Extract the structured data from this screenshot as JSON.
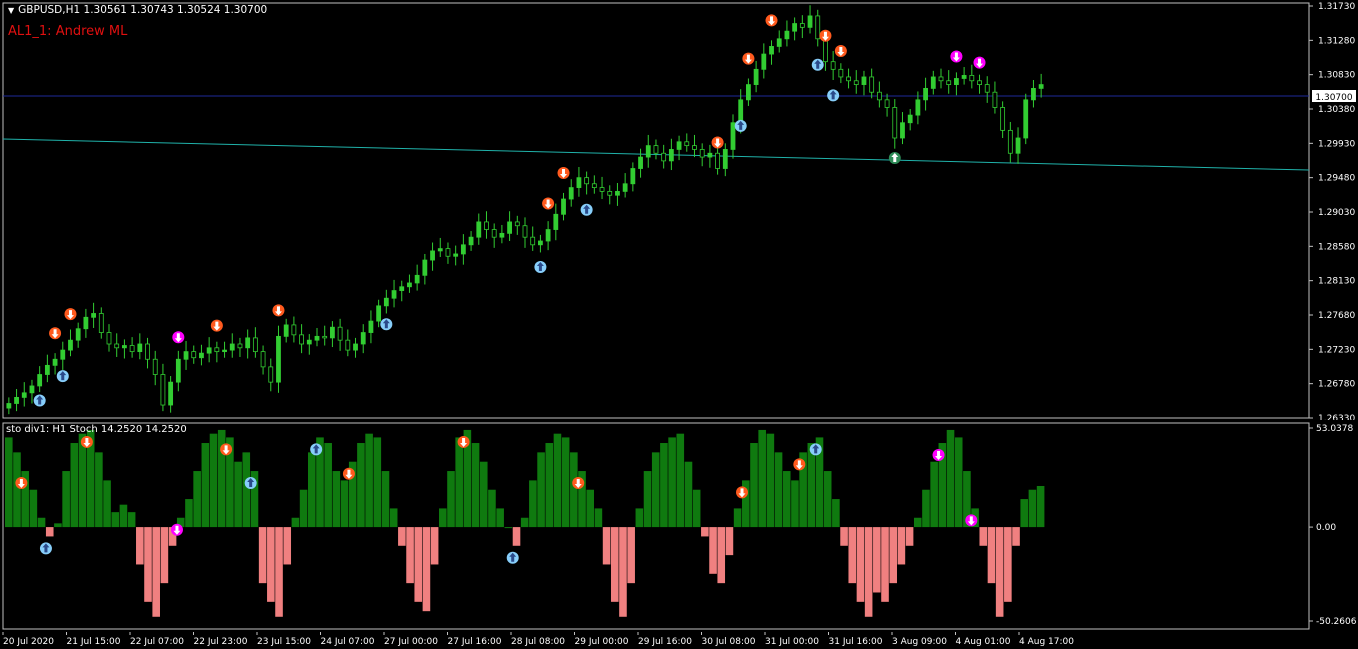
{
  "header": {
    "symbol_info": "GBPUSD,H1  1.30561 1.30743 1.30524 1.30700",
    "indicator_label": "AL1_1: Andrew ML",
    "sub_window_title": "sto div1: H1 Stoch 14.2520 14.2520"
  },
  "price_axis": {
    "labels": [
      "1.31730",
      "1.31280",
      "1.30830",
      "1.30380",
      "1.29930",
      "1.29480",
      "1.29030",
      "1.28580",
      "1.28130",
      "1.27680",
      "1.27230",
      "1.26780",
      "1.26330"
    ],
    "current_price_label": "1.30700"
  },
  "osc_axis": {
    "labels": [
      "53.0378",
      "0.00",
      "-50.2606"
    ]
  },
  "time_axis": {
    "labels": [
      "20 Jul 2020",
      "21 Jul 15:00",
      "22 Jul 07:00",
      "22 Jul 23:00",
      "23 Jul 15:00",
      "24 Jul 07:00",
      "27 Jul 00:00",
      "27 Jul 16:00",
      "28 Jul 08:00",
      "29 Jul 00:00",
      "29 Jul 16:00",
      "30 Jul 08:00",
      "31 Jul 00:00",
      "31 Jul 16:00",
      "3 Aug 09:00",
      "4 Aug 01:00",
      "4 Aug 17:00"
    ]
  },
  "colors": {
    "background": "#000000",
    "bull": "#32cd32",
    "osc_positive": "#0f7a0f",
    "osc_negative": "#f08080",
    "trendline": "#20b2aa",
    "price_level": "#1e2a9a",
    "sell_arrow": "#ff5a1e",
    "buy_arrow": "#87cefa",
    "hidden_div": "#ff00ff",
    "grid": "#c0c0c0"
  },
  "chart_data": [
    {
      "type": "candlestick",
      "title": "GBPUSD,H1",
      "ylim": [
        1.2633,
        1.3173
      ],
      "current_price": 1.307,
      "closes": [
        1.2652,
        1.266,
        1.2666,
        1.2675,
        1.269,
        1.2702,
        1.271,
        1.2722,
        1.2735,
        1.275,
        1.2765,
        1.277,
        1.2745,
        1.273,
        1.2725,
        1.2728,
        1.272,
        1.273,
        1.271,
        1.269,
        1.265,
        1.268,
        1.271,
        1.272,
        1.2712,
        1.2718,
        1.2725,
        1.272,
        1.2722,
        1.273,
        1.2725,
        1.2738,
        1.272,
        1.27,
        1.268,
        1.274,
        1.2755,
        1.2742,
        1.273,
        1.2735,
        1.274,
        1.2738,
        1.2752,
        1.2735,
        1.2722,
        1.273,
        1.2745,
        1.276,
        1.278,
        1.279,
        1.28,
        1.2805,
        1.281,
        1.282,
        1.284,
        1.2852,
        1.2855,
        1.2845,
        1.2848,
        1.286,
        1.287,
        1.289,
        1.288,
        1.287,
        1.2875,
        1.289,
        1.2885,
        1.287,
        1.286,
        1.2865,
        1.288,
        1.29,
        1.292,
        1.2935,
        1.2948,
        1.294,
        1.2935,
        1.293,
        1.2925,
        1.293,
        1.294,
        1.296,
        1.2975,
        1.299,
        1.298,
        1.297,
        1.2985,
        1.2995,
        1.299,
        1.2985,
        1.2975,
        1.298,
        1.296,
        1.2985,
        1.302,
        1.305,
        1.307,
        1.309,
        1.311,
        1.312,
        1.313,
        1.314,
        1.315,
        1.3145,
        1.316,
        1.313,
        1.31,
        1.309,
        1.308,
        1.3075,
        1.307,
        1.308,
        1.306,
        1.305,
        1.304,
        1.3,
        1.302,
        1.303,
        1.305,
        1.3065,
        1.308,
        1.3075,
        1.307,
        1.3078,
        1.3082,
        1.3075,
        1.307,
        1.306,
        1.304,
        1.301,
        1.298,
        1.3,
        1.305,
        1.3065,
        1.307
      ]
    },
    {
      "type": "bar",
      "title": "sto div1: H1 Stoch 14.2520 14.2520",
      "ylim": [
        -50.2606,
        53.0378
      ],
      "values": [
        48,
        40,
        30,
        20,
        5,
        -5,
        2,
        30,
        45,
        50,
        52,
        40,
        25,
        8,
        12,
        8,
        -20,
        -40,
        -48,
        -30,
        -10,
        5,
        15,
        30,
        45,
        50,
        52,
        48,
        35,
        40,
        30,
        -30,
        -40,
        -48,
        -20,
        5,
        20,
        40,
        48,
        45,
        30,
        25,
        35,
        45,
        50,
        48,
        30,
        10,
        -10,
        -30,
        -40,
        -45,
        -20,
        10,
        30,
        48,
        52,
        45,
        35,
        20,
        10,
        0,
        -10,
        5,
        25,
        40,
        45,
        50,
        48,
        40,
        30,
        20,
        10,
        -20,
        -40,
        -48,
        -30,
        10,
        30,
        40,
        45,
        48,
        50,
        35,
        20,
        -5,
        -25,
        -30,
        -15,
        10,
        25,
        45,
        52,
        50,
        40,
        30,
        25,
        40,
        45,
        48,
        30,
        15,
        -10,
        -30,
        -40,
        -48,
        -35,
        -40,
        -30,
        -20,
        -10,
        5,
        20,
        35,
        45,
        52,
        48,
        30,
        10,
        -10,
        -30,
        -48,
        -40,
        -10,
        15,
        20,
        22
      ]
    }
  ]
}
